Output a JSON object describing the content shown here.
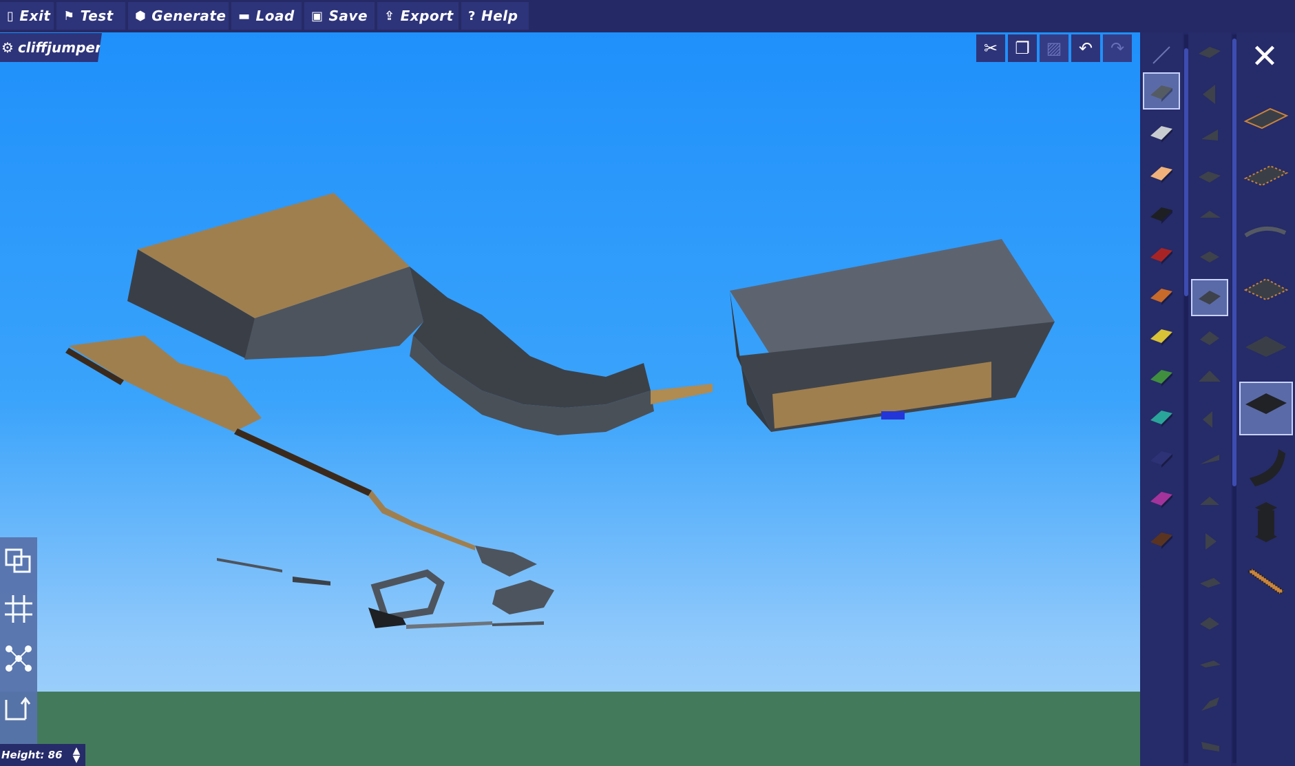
{
  "menu": {
    "exit": "Exit",
    "test": "Test",
    "generate": "Generate",
    "load": "Load",
    "save": "Save",
    "export": "Export",
    "help": "Help"
  },
  "level": {
    "name": "cliffjumper"
  },
  "height": {
    "label": "Height: 86"
  },
  "colors": {
    "sky_top": "#1f90fb",
    "sky_bottom": "#a9d6fb",
    "ground": "#437a5b",
    "panel": "#262b69",
    "menu_button": "#2e347a",
    "selected_slot": "#5a6aa8"
  },
  "palette_colors": [
    "#555b63",
    "#c8ccd0",
    "#f0b27a",
    "#1d1f22",
    "#a82424",
    "#c86a2a",
    "#d8c236",
    "#3f8f3f",
    "#2aa59a",
    "#2c3275",
    "#a4339c",
    "#5a3420"
  ],
  "icons": {
    "exit": "exit-door-icon",
    "test": "flag-icon",
    "generate": "dice-icon",
    "load": "folder-icon",
    "save": "floppy-icon",
    "export": "export-icon",
    "help": "help-circle-icon",
    "cut": "scissors-icon",
    "copy": "copy-icon",
    "paste": "paste-icon",
    "undo": "undo-icon",
    "redo": "redo-icon",
    "close": "close-icon"
  }
}
